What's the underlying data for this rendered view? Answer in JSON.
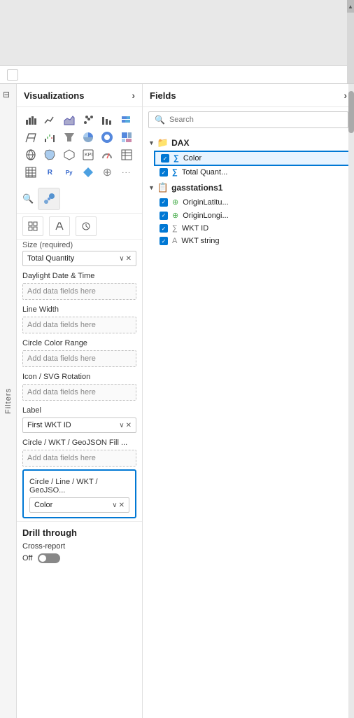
{
  "topBar": {
    "height": 120,
    "scrollArrow": "▲"
  },
  "filters": {
    "label": "Filters"
  },
  "visualizations": {
    "header": "Visualizations",
    "expandIcon": "›",
    "searchPlaceholder": "",
    "icons": [
      {
        "name": "bar-chart-icon",
        "symbol": "📊"
      },
      {
        "name": "line-chart-icon",
        "symbol": "📈"
      },
      {
        "name": "area-chart-icon",
        "symbol": "〰"
      },
      {
        "name": "scatter-icon",
        "symbol": "⠿"
      },
      {
        "name": "column-chart-icon",
        "symbol": "▐"
      },
      {
        "name": "stacked-bar-icon",
        "symbol": "▬"
      },
      {
        "name": "ribbon-chart-icon",
        "symbol": "🎗"
      },
      {
        "name": "waterfall-icon",
        "symbol": "📉"
      },
      {
        "name": "funnel-icon",
        "symbol": "⊽"
      },
      {
        "name": "pie-chart-icon",
        "symbol": "◔"
      },
      {
        "name": "donut-icon",
        "symbol": "◌"
      },
      {
        "name": "treemap-icon",
        "symbol": "⊞"
      },
      {
        "name": "map-icon",
        "symbol": "🗺"
      },
      {
        "name": "filled-map-icon",
        "symbol": "🌍"
      },
      {
        "name": "shape-map-icon",
        "symbol": "⬡"
      },
      {
        "name": "kpi-icon",
        "symbol": "📌"
      },
      {
        "name": "gauge-icon",
        "symbol": "⊙"
      },
      {
        "name": "table-icon",
        "symbol": "▦"
      },
      {
        "name": "matrix-icon",
        "symbol": "⊞"
      },
      {
        "name": "r-script-icon",
        "symbol": "R"
      },
      {
        "name": "python-icon",
        "symbol": "Py"
      },
      {
        "name": "azure-map-icon",
        "symbol": "🔷"
      },
      {
        "name": "custom-icon",
        "symbol": "⊕"
      },
      {
        "name": "more-icon",
        "symbol": "···"
      }
    ],
    "sizeLabel": "Size (required)",
    "totalQuantityField": "Total Quantity",
    "sections": [
      {
        "name": "Daylight Date & Time",
        "dropZoneLabel": "Add data fields here"
      },
      {
        "name": "Line Width",
        "dropZoneLabel": "Add data fields here"
      },
      {
        "name": "Circle Color Range",
        "dropZoneLabel": "Add data fields here"
      },
      {
        "name": "Icon / SVG Rotation",
        "dropZoneLabel": "Add data fields here"
      },
      {
        "name": "Label",
        "dropZoneLabel": null,
        "fieldValue": "First WKT ID"
      },
      {
        "name": "Circle / WKT / GeoJSON Fill ...",
        "dropZoneLabel": "Add data fields here"
      }
    ],
    "highlightedSection": {
      "label": "Circle / Line / WKT / GeoJSO...",
      "fieldValue": "Color"
    },
    "drillThrough": {
      "title": "Drill through",
      "crossReport": "Cross-report",
      "toggleState": "Off"
    }
  },
  "fields": {
    "header": "Fields",
    "expandIcon": "›",
    "search": {
      "placeholder": "Search",
      "icon": "🔍"
    },
    "groups": [
      {
        "name": "DAX",
        "expanded": true,
        "icon": "📁",
        "items": [
          {
            "name": "Color",
            "type": "measure",
            "typeIcon": "∑",
            "checked": true,
            "selected": true
          },
          {
            "name": "Total Quant...",
            "type": "measure",
            "typeIcon": "∑",
            "checked": true,
            "selected": false
          }
        ]
      },
      {
        "name": "gasstations1",
        "expanded": true,
        "icon": "📋",
        "items": [
          {
            "name": "OriginLatitu...",
            "type": "globe",
            "typeIcon": "⊕",
            "checked": true,
            "selected": false
          },
          {
            "name": "OriginLongi...",
            "type": "globe",
            "typeIcon": "⊕",
            "checked": true,
            "selected": false
          },
          {
            "name": "WKT ID",
            "type": "measure",
            "typeIcon": "∑",
            "checked": true,
            "selected": false
          },
          {
            "name": "WKT string",
            "type": "text",
            "typeIcon": "A",
            "checked": true,
            "selected": false
          }
        ]
      }
    ]
  }
}
